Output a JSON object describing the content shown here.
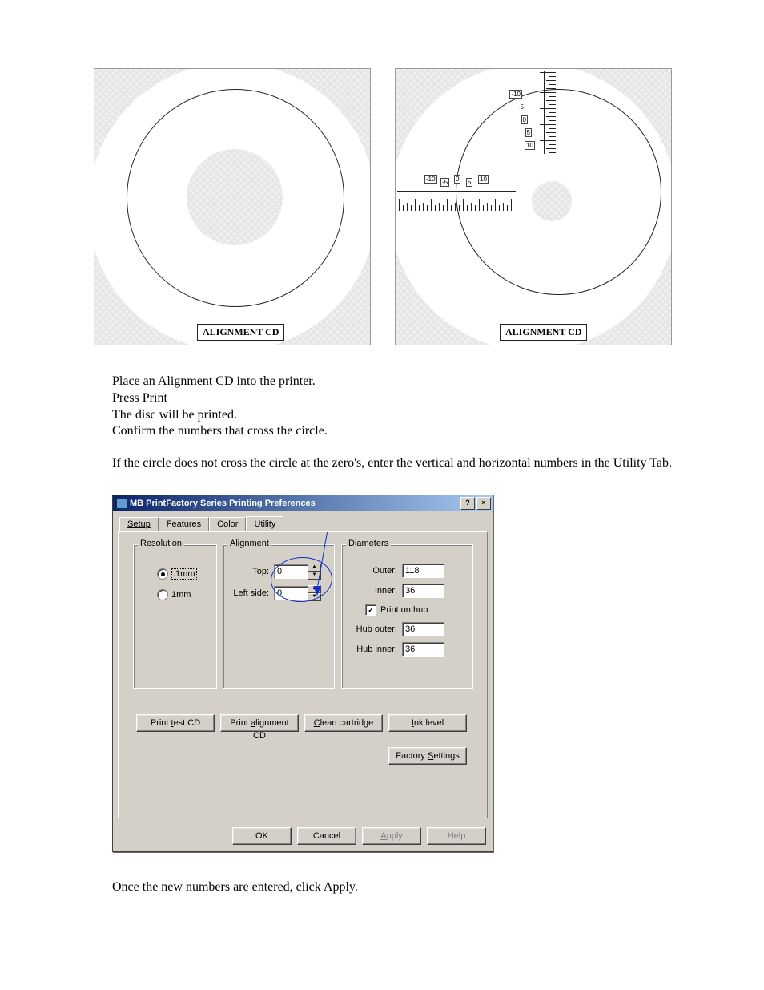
{
  "cd": {
    "label": "ALIGNMENT CD",
    "scale_values": [
      "-10",
      "-5",
      "0",
      "5",
      "10"
    ]
  },
  "instructions": {
    "line1": "Place an Alignment CD into the printer.",
    "line2": "Press Print",
    "line3": "The disc will be printed.",
    "line4": "Confirm the numbers that cross the circle."
  },
  "note": "If the circle does not cross the circle at the zero's, enter the vertical and horizontal numbers in the Utility Tab.",
  "dialog": {
    "title": "MB PrintFactory Series Printing Preferences",
    "tabs": {
      "setup": "Setup",
      "features": "Features",
      "color": "Color",
      "utility": "Utility"
    },
    "resolution": {
      "legend": "Resolution",
      "opt1": ".1mm",
      "opt2": "1mm"
    },
    "alignment": {
      "legend": "Alignment",
      "top_label": "Top:",
      "top_value": "0",
      "left_label": "Left side:",
      "left_value": "0"
    },
    "diameters": {
      "legend": "Diameters",
      "outer_label": "Outer:",
      "outer_value": "118",
      "inner_label": "Inner:",
      "inner_value": "36",
      "print_on_hub": "Print on hub",
      "hub_outer_label": "Hub outer:",
      "hub_outer_value": "36",
      "hub_inner_label": "Hub inner:",
      "hub_inner_value": "36"
    },
    "buttons": {
      "print_test": "Print test CD",
      "print_alignment": "Print alignment CD",
      "clean": "Clean cartridge",
      "ink": "Ink level",
      "factory": "Factory Settings",
      "ok": "OK",
      "cancel": "Cancel",
      "apply": "Apply",
      "help": "Help"
    }
  },
  "final": "Once the new numbers are entered, click Apply."
}
